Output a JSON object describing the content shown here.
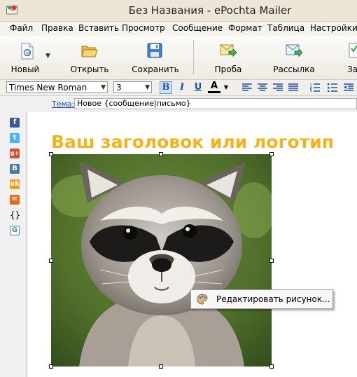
{
  "window": {
    "title": "Без Названия - ePochta Mailer"
  },
  "menu": [
    "Файл",
    "Правка",
    "Вставить",
    "Просмотр",
    "Сообщение",
    "Формат",
    "Таблица",
    "Настройки"
  ],
  "toolbar": {
    "new_label": "Новый",
    "open_label": "Открыть",
    "save_label": "Сохранить",
    "test_label": "Проба",
    "send_label": "Рассылка",
    "extra_label": "За"
  },
  "format": {
    "font": "Times New Roman",
    "size": "3",
    "bold": "B",
    "italic": "I",
    "underline": "U",
    "text_color": "A"
  },
  "subject": {
    "label": "Тема:",
    "value": "Новое {сообщение|письмо}"
  },
  "sidebar": {
    "curly": "{}",
    "icons": [
      "facebook-icon",
      "twitter-icon",
      "google-plus-icon",
      "vk-icon",
      "odnoklassniki-icon",
      "email-icon",
      "code-icon",
      "google-icon"
    ]
  },
  "editor": {
    "headline": "Ваш заголовок или логотип",
    "headline_color": "#f3b319"
  },
  "context_menu": {
    "edit_picture_label": "Редактировать рисунок..."
  }
}
